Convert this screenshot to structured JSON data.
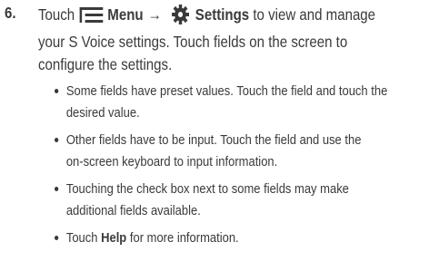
{
  "step": {
    "number": "6.",
    "line1_prefix": "Touch",
    "menu_label": "Menu",
    "arrow": "→",
    "settings_label": "Settings",
    "line1_suffix": "to view and manage",
    "line2": "your S Voice settings. Touch fields on the screen to",
    "line3": "configure the settings."
  },
  "bullets": [
    {
      "line1": "Some fields have preset values. Touch the field and touch the",
      "line2": "desired value."
    },
    {
      "line1": "Other fields have to be input. Touch the field and use the",
      "line2": "on-screen keyboard to input information."
    },
    {
      "line1": "Touching the check box next to some fields may make",
      "line2": "additional fields available."
    },
    {
      "prefix": "Touch",
      "bold": "Help",
      "suffix": "for more information."
    }
  ],
  "icons": {
    "menu": "menu-icon",
    "settings": "gear-icon"
  },
  "colors": {
    "text": "#3a3a3a"
  }
}
